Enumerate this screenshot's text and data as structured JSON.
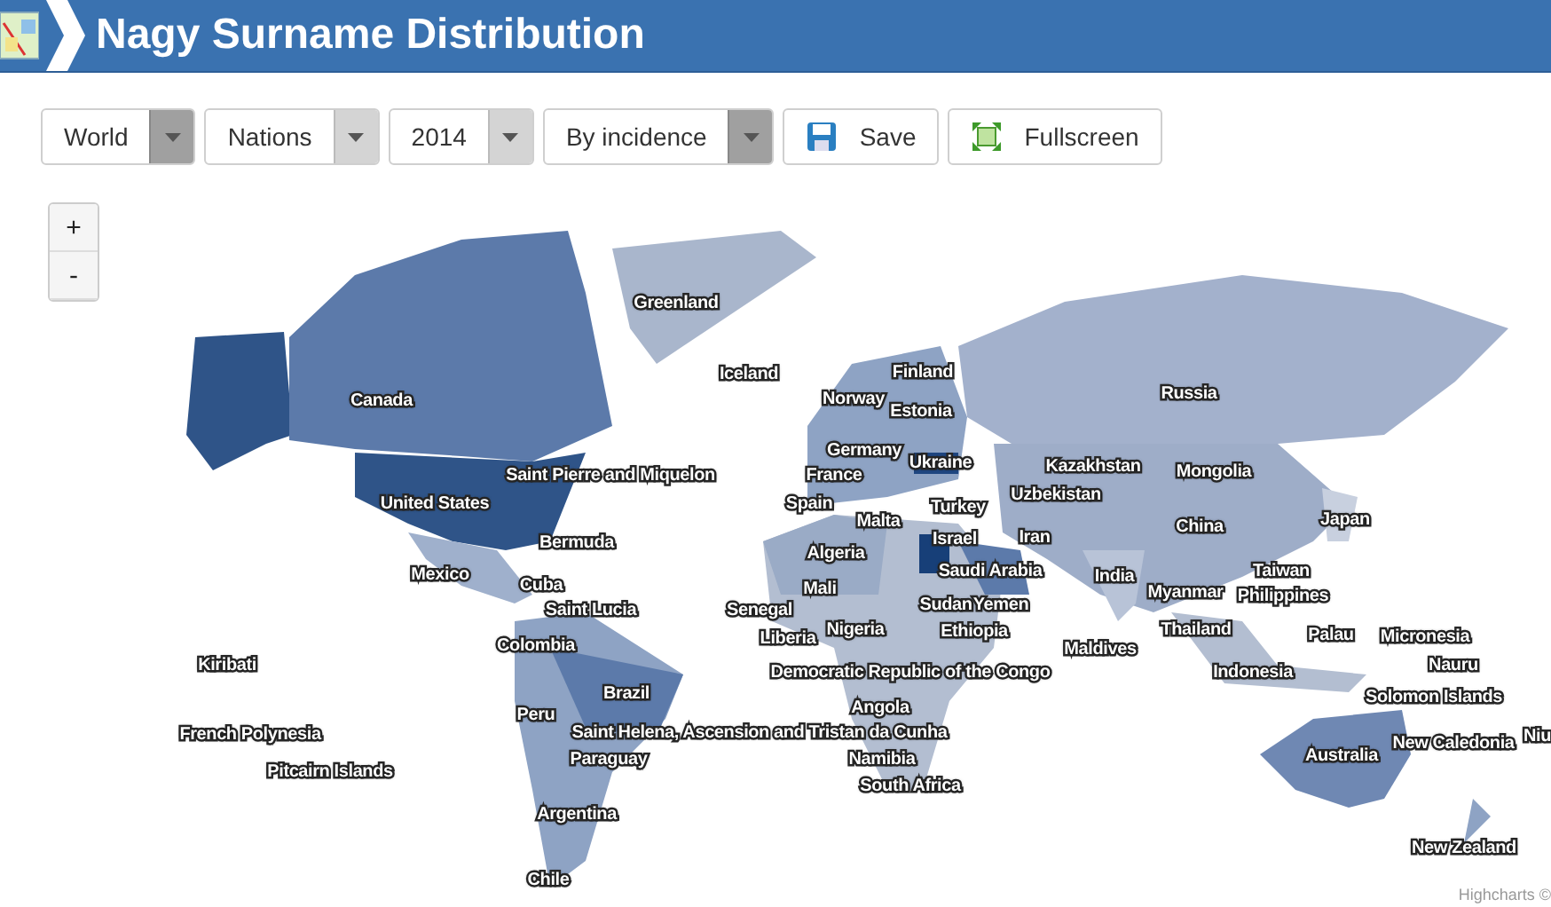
{
  "header": {
    "title": "Nagy Surname Distribution"
  },
  "toolbar": {
    "dropdowns": [
      {
        "label": "World",
        "active": true
      },
      {
        "label": "Nations",
        "active": false
      },
      {
        "label": "2014",
        "active": false
      },
      {
        "label": "By incidence",
        "active": true
      }
    ],
    "buttons": [
      {
        "label": "Save",
        "kind": "save"
      },
      {
        "label": "Fullscreen",
        "kind": "fullscreen"
      }
    ]
  },
  "map": {
    "zoom_buttons": [
      "+",
      "-"
    ],
    "labels": [
      "Greenland",
      "Iceland",
      "Canada",
      "Saint Pierre and Miquelon",
      "United States",
      "Bermuda",
      "Mexico",
      "Cuba",
      "Saint Lucia",
      "Colombia",
      "Kiribati",
      "Brazil",
      "Peru",
      "French Polynesia",
      "Saint Helena, Ascension and Tristan da Cunha",
      "Pitcairn Islands",
      "Paraguay",
      "Argentina",
      "Chile",
      "Finland",
      "Norway",
      "Estonia",
      "Germany",
      "Ukraine",
      "France",
      "Spain",
      "Turkey",
      "Malta",
      "Israel",
      "Iran",
      "Algeria",
      "Saudi Arabia",
      "Mali",
      "Senegal",
      "Sudan",
      "Yemen",
      "Liberia",
      "Nigeria",
      "Ethiopia",
      "Maldives",
      "Democratic Republic of the Congo",
      "Angola",
      "Namibia",
      "South Africa",
      "Russia",
      "Kazakhstan",
      "Uzbekistan",
      "Mongolia",
      "China",
      "Japan",
      "India",
      "Taiwan",
      "Myanmar",
      "Philippines",
      "Thailand",
      "Palau",
      "Micronesia",
      "Indonesia",
      "Nauru",
      "Solomon Islands",
      "Australia",
      "New Caledonia",
      "Niu",
      "New Zealand"
    ],
    "credit": "Highcharts ©"
  }
}
